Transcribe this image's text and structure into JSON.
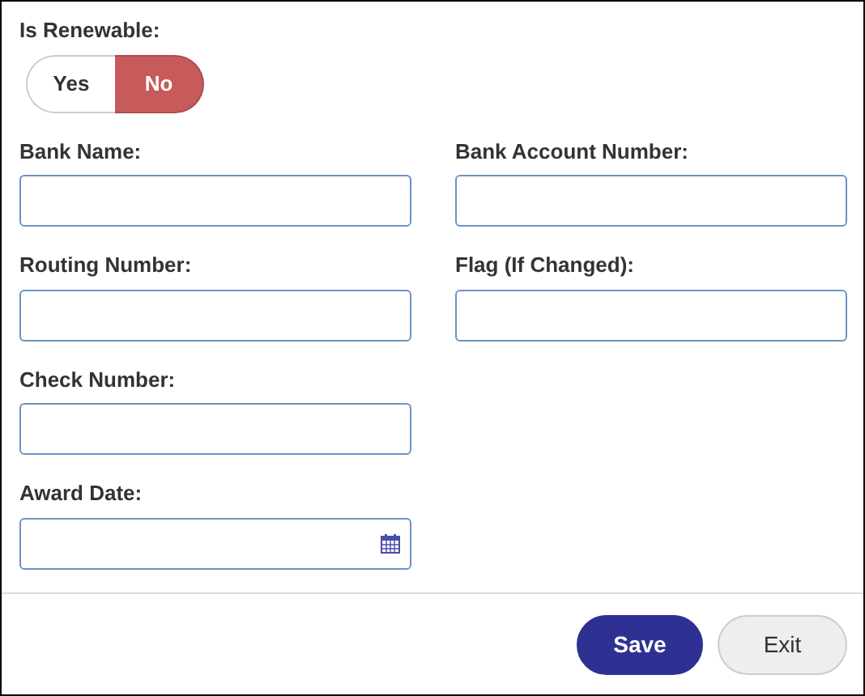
{
  "renewable": {
    "label": "Is Renewable:",
    "options": [
      {
        "label": "Yes",
        "selected": false
      },
      {
        "label": "No",
        "selected": true
      }
    ]
  },
  "rows": [
    [
      {
        "label": "Bank Name:",
        "kind": "text"
      },
      {
        "label": "Bank Account Number:",
        "kind": "text"
      }
    ],
    [
      {
        "label": "Routing Number:",
        "kind": "text"
      },
      {
        "label": "Flag (If Changed):",
        "kind": "text"
      }
    ],
    [
      {
        "label": "Check Number:",
        "kind": "text"
      }
    ],
    [
      {
        "label": "Award Date:",
        "kind": "date"
      }
    ]
  ],
  "buttons": [
    {
      "label": "Save",
      "kind": "primary"
    },
    {
      "label": "Exit",
      "kind": "secondary"
    }
  ]
}
